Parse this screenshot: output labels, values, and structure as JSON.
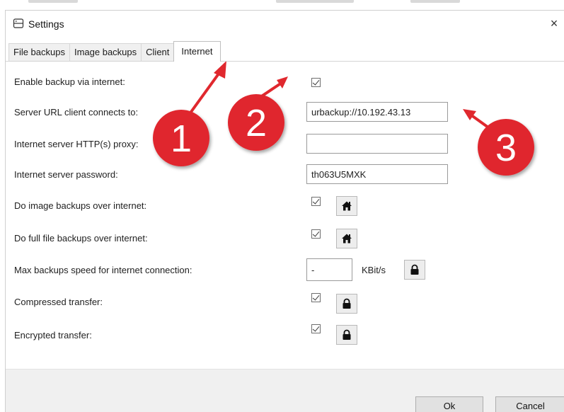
{
  "window": {
    "title": "Settings",
    "close_glyph": "×"
  },
  "tabs": [
    {
      "label": "File backups",
      "active": false
    },
    {
      "label": "Image backups",
      "active": false
    },
    {
      "label": "Client",
      "active": false
    },
    {
      "label": "Internet",
      "active": true
    }
  ],
  "settings": {
    "enable_backup": {
      "label": "Enable backup via internet:",
      "checked": true
    },
    "server_url": {
      "label": "Server URL client connects to:",
      "value": "urbackup://10.192.43.13"
    },
    "http_proxy": {
      "label": "Internet server HTTP(s) proxy:",
      "value": ""
    },
    "password": {
      "label": "Internet server password:",
      "value": "th063U5MXK"
    },
    "image_backups": {
      "label": "Do image backups over internet:",
      "checked": true,
      "icon": "home-icon"
    },
    "full_file_backups": {
      "label": "Do full file backups over internet:",
      "checked": true,
      "icon": "home-icon"
    },
    "max_speed": {
      "label": "Max backups speed for internet connection:",
      "value": "-",
      "unit": "KBit/s",
      "icon": "lock-icon"
    },
    "compressed": {
      "label": "Compressed transfer:",
      "checked": true,
      "icon": "lock-icon"
    },
    "encrypted": {
      "label": "Encrypted transfer:",
      "checked": true,
      "icon": "lock-icon"
    }
  },
  "footer": {
    "ok_label": "Ok",
    "cancel_label": "Cancel"
  },
  "annotations": [
    {
      "number": "1"
    },
    {
      "number": "2"
    },
    {
      "number": "3"
    }
  ],
  "colors": {
    "annotation_red": "#e0282e",
    "annotation_text": "#ffffff"
  }
}
